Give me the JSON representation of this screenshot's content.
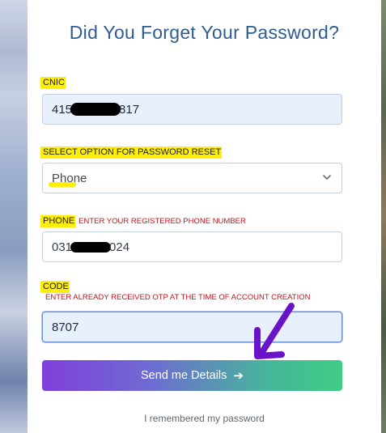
{
  "page": {
    "title": "Did You Forget Your Password?"
  },
  "form": {
    "cnic": {
      "label": "CNIC",
      "value_prefix": "415",
      "value_suffix": "817"
    },
    "reset_option": {
      "label": "SELECT OPTION FOR PASSWORD RESET",
      "selected": "Phone"
    },
    "phone": {
      "label": "PHONE",
      "hint": "ENTER YOUR REGISTERED PHONE NUMBER",
      "value_prefix": "031",
      "value_suffix": "024"
    },
    "code": {
      "label": "CODE",
      "hint": "ENTER ALREADY RECEIVED OTP AT THE TIME OF ACCOUNT CREATION",
      "value": "8707"
    },
    "submit": {
      "label": "Send me Details",
      "icon": "arrow-right-icon"
    },
    "footer_link": "I remembered my password"
  },
  "colors": {
    "title": "#2f5c8f",
    "highlight": "#ffee0a",
    "hint_red": "#c0141b",
    "button_gradient_start": "#7f3fd9",
    "button_gradient_end": "#3fcc84",
    "annotation_arrow": "#6a14c9"
  }
}
